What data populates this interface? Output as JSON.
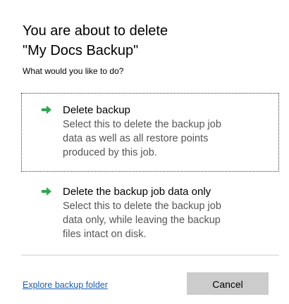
{
  "dialog": {
    "title_line1": "You are about to delete",
    "title_line2": "\"My Docs Backup\"",
    "prompt": "What would you like to do?"
  },
  "options": [
    {
      "title": "Delete backup",
      "description_lines": [
        "Select this to delete the backup job",
        "data as well as all restore points",
        "produced by this job."
      ],
      "icon": "green-arrow-icon"
    },
    {
      "title": "Delete the backup job data only",
      "description_lines": [
        "Select this to delete the backup job",
        "data only, while leaving the backup",
        "files intact on disk."
      ],
      "icon": "green-arrow-icon"
    }
  ],
  "footer": {
    "link_text": "Explore backup folder",
    "cancel_label": "Cancel"
  },
  "colors": {
    "arrow_green": "#2fa84f",
    "link_blue": "#1a5fb4",
    "button_gray": "#cccccc",
    "description_gray": "#555555"
  }
}
